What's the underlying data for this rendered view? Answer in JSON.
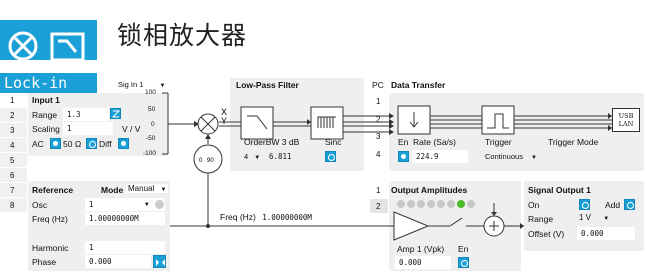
{
  "header": {
    "title": "锁相放大器",
    "tab_label": "Lock-in"
  },
  "row_numbers": [
    "1",
    "2",
    "3",
    "4",
    "5",
    "6",
    "7",
    "8"
  ],
  "input": {
    "signal_select": "Sig In 1",
    "title": "Input 1",
    "range_label": "Range",
    "range_value": "1.3",
    "scaling_label": "Scaling",
    "scaling_value": "1",
    "scaling_unit": "V / V",
    "ac_label": "AC",
    "ohm_label": "50 Ω",
    "diff_label": "Diff",
    "meter_ticks": [
      "100",
      "50",
      "0",
      "-50",
      "-100"
    ]
  },
  "mixer": {
    "x_label": "X",
    "y_label": "Y",
    "phase_options": [
      "0",
      "90"
    ]
  },
  "lowpass": {
    "title": "Low-Pass Filter",
    "bw_label": "OrderBW 3 dB",
    "order_value": "4",
    "bw_value": "6.811",
    "sinc_label": "Sinc"
  },
  "data_transfer": {
    "pc_label": "PC",
    "title": "Data Transfer",
    "rownums": [
      "1",
      "2",
      "3",
      "4"
    ],
    "en_label": "En",
    "rate_label": "Rate (Sa/s)",
    "rate_value": "224.9",
    "trigger_label": "Trigger",
    "trigger_mode_label": "Trigger Mode",
    "trigger_value": "Continuous",
    "usb_label": "USB",
    "lan_label": "LAN"
  },
  "reference": {
    "title": "Reference",
    "mode_label": "Mode",
    "mode_value": "Manual",
    "osc_label": "Osc",
    "osc_value": "1",
    "freq_label": "Freq (Hz)",
    "freq_value": "1.00000000M",
    "harmonic_label": "Harmonic",
    "harmonic_value": "1",
    "phase_label": "Phase",
    "phase_value": "0.000"
  },
  "signal_line": {
    "freq_text": "Freq (Hz)",
    "freq_value": "1.00000000M"
  },
  "output_amplitudes": {
    "rownums": [
      "1",
      "2"
    ],
    "title": "Output Amplitudes",
    "amp_label": "Amp 1 (Vpk)",
    "en_label": "En",
    "amp_value": "0.000",
    "leds": [
      "#c8c8c8",
      "#c8c8c8",
      "#c8c8c8",
      "#c8c8c8",
      "#c8c8c8",
      "#c8c8c8",
      "#4cbb2a",
      "#c8c8c8"
    ]
  },
  "signal_output": {
    "title": "Signal Output 1",
    "on_label": "On",
    "add_label": "Add",
    "range_label": "Range",
    "range_value": "1 V",
    "offset_label": "Offset (V)",
    "offset_value": "0.000"
  },
  "colors": {
    "accent": "#1aa0d6",
    "panel": "#efefef",
    "led_green": "#4cbb2a"
  }
}
